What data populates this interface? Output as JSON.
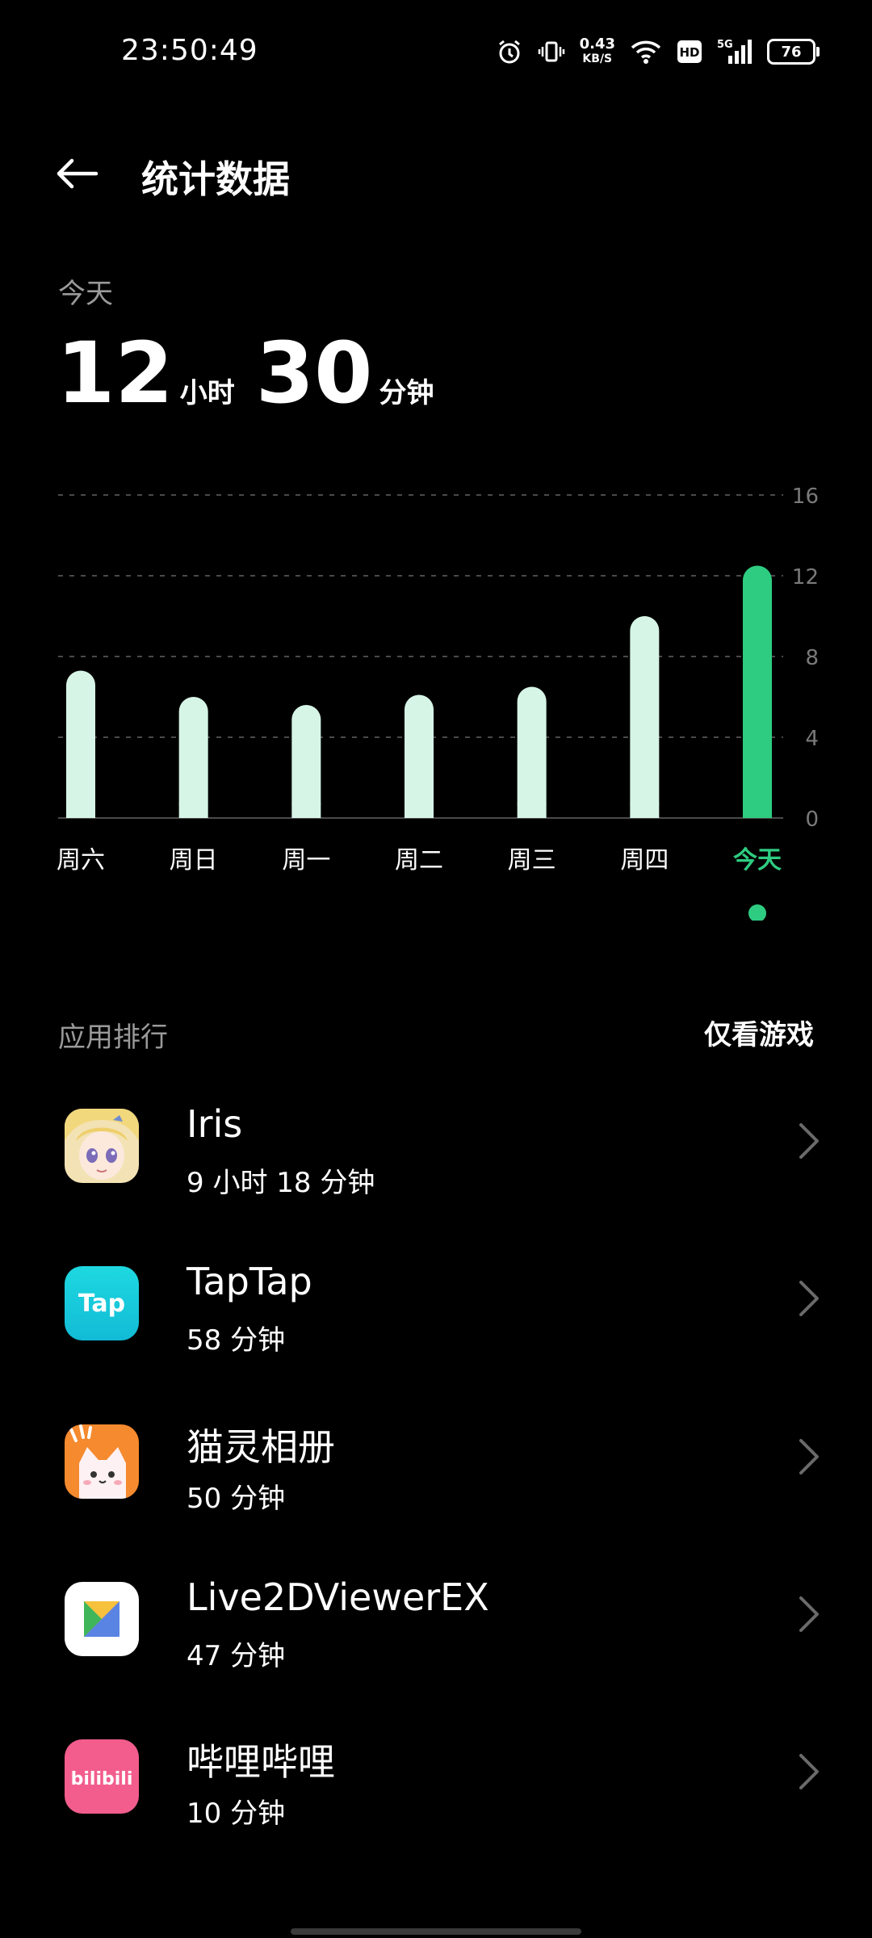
{
  "status_bar": {
    "time": "23:50:49",
    "net_speed_value": "0.43",
    "net_speed_unit": "KB/S",
    "network_type": "5G",
    "hd_label": "HD",
    "battery": "76"
  },
  "header": {
    "title": "统计数据"
  },
  "summary": {
    "label": "今天",
    "hours": "12",
    "hours_unit": "小时",
    "minutes": "30",
    "minutes_unit": "分钟"
  },
  "chart_data": {
    "type": "bar",
    "categories": [
      "周六",
      "周日",
      "周一",
      "周二",
      "周三",
      "周四",
      "今天"
    ],
    "values": [
      7.3,
      6.0,
      5.6,
      6.1,
      6.5,
      10.0,
      12.5
    ],
    "yticks": [
      0,
      4,
      8,
      12,
      16
    ],
    "ylim": [
      0,
      16
    ],
    "highlight_index": 6,
    "colors": {
      "bar": "#D6F5E6",
      "highlight": "#2ECC81",
      "grid": "#4A4A4A",
      "tick": "#7A7A7A"
    }
  },
  "ranking": {
    "title": "应用排行",
    "filter_label": "仅看游戏",
    "apps": [
      {
        "name": "Iris",
        "time": "9 小时 18 分钟",
        "icon": "iris-app-icon"
      },
      {
        "name": "TapTap",
        "time": "58 分钟",
        "icon": "taptap-app-icon",
        "icon_text": "Tap"
      },
      {
        "name": "猫灵相册",
        "time": "50 分钟",
        "icon": "cat-album-app-icon"
      },
      {
        "name": "Live2DViewerEX",
        "time": "47 分钟",
        "icon": "live2d-app-icon"
      },
      {
        "name": "哔哩哔哩",
        "time": "10 分钟",
        "icon": "bilibili-app-icon",
        "icon_text": "bilibili"
      }
    ]
  }
}
